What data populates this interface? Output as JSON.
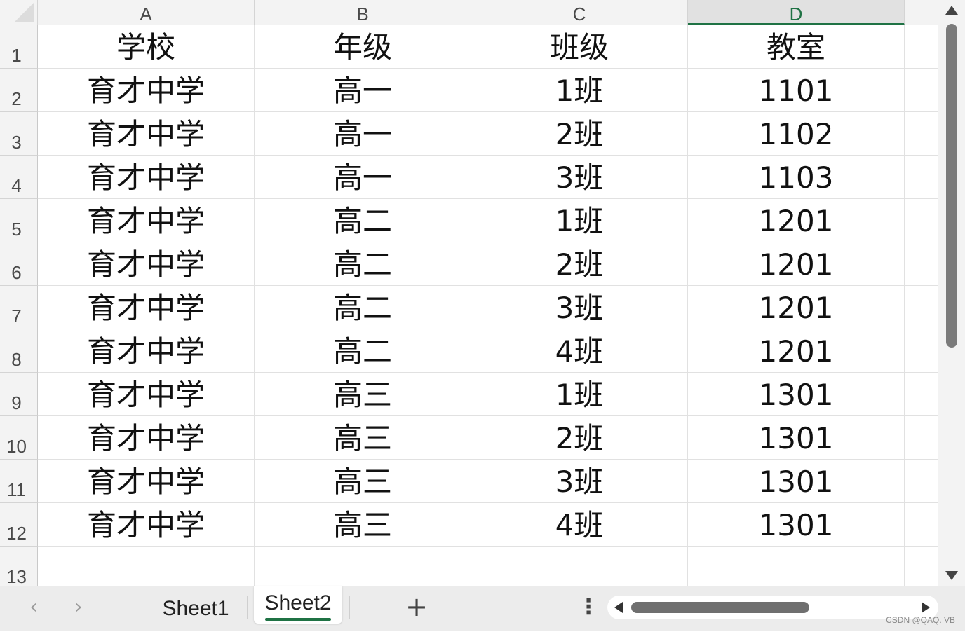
{
  "columns": [
    {
      "letter": "A",
      "active": false
    },
    {
      "letter": "B",
      "active": false
    },
    {
      "letter": "C",
      "active": false
    },
    {
      "letter": "D",
      "active": true
    },
    {
      "letter": "",
      "active": false
    }
  ],
  "row_numbers": [
    "1",
    "2",
    "3",
    "4",
    "5",
    "6",
    "7",
    "8",
    "9",
    "10",
    "11",
    "12",
    "13"
  ],
  "rows": [
    [
      "学校",
      "年级",
      "班级",
      "教室"
    ],
    [
      "育才中学",
      "高一",
      "1班",
      "1101"
    ],
    [
      "育才中学",
      "高一",
      "2班",
      "1102"
    ],
    [
      "育才中学",
      "高一",
      "3班",
      "1103"
    ],
    [
      "育才中学",
      "高二",
      "1班",
      "1201"
    ],
    [
      "育才中学",
      "高二",
      "2班",
      "1201"
    ],
    [
      "育才中学",
      "高二",
      "3班",
      "1201"
    ],
    [
      "育才中学",
      "高二",
      "4班",
      "1201"
    ],
    [
      "育才中学",
      "高三",
      "1班",
      "1301"
    ],
    [
      "育才中学",
      "高三",
      "2班",
      "1301"
    ],
    [
      "育才中学",
      "高三",
      "3班",
      "1301"
    ],
    [
      "育才中学",
      "高三",
      "4班",
      "1301"
    ],
    [
      "",
      "",
      "",
      ""
    ]
  ],
  "tabs": {
    "prev_icon": "‹",
    "next_icon": "›",
    "sheets": [
      {
        "label": "Sheet1",
        "active": false
      },
      {
        "label": "Sheet2",
        "active": true
      }
    ],
    "add_icon": "+",
    "more_icon": "⋮"
  },
  "colors": {
    "accent_green": "#1f7244",
    "header_bg": "#f3f3f3"
  },
  "watermark": "CSDN @QAQ. VB"
}
